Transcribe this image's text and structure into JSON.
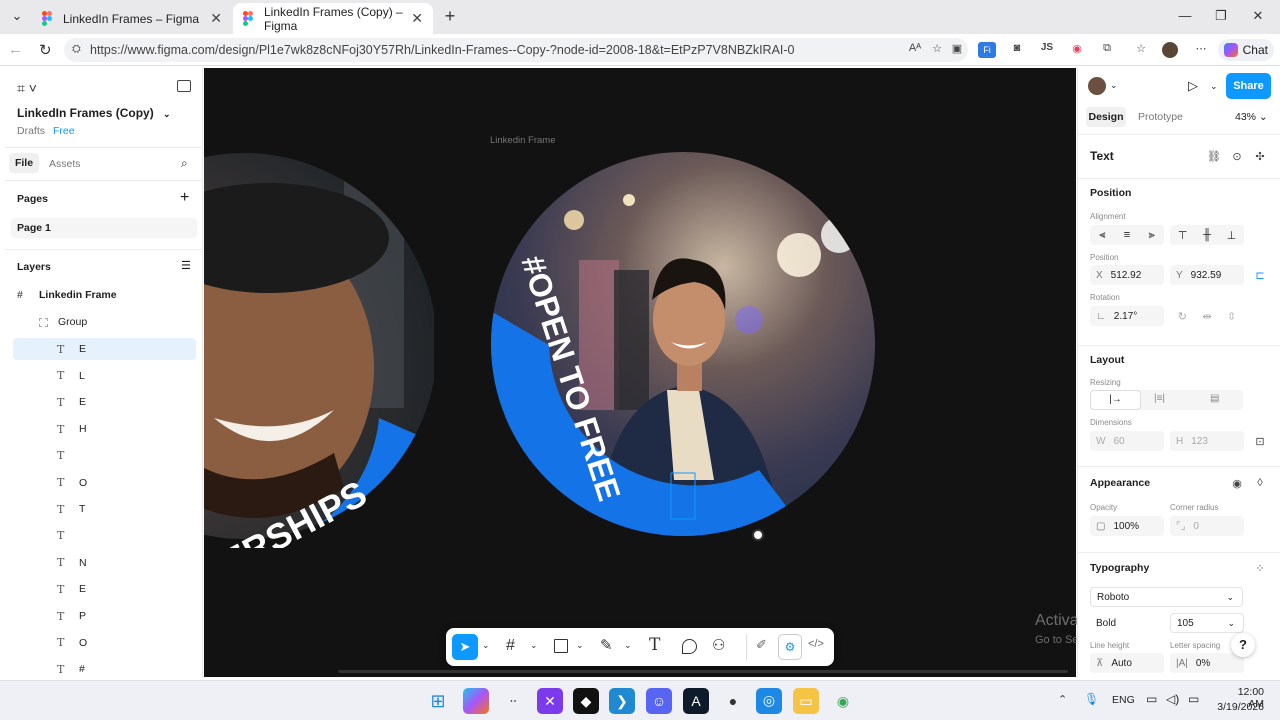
{
  "browser": {
    "tabs": [
      {
        "title": "LinkedIn Frames – Figma"
      },
      {
        "title": "LinkedIn Frames (Copy) – Figma"
      }
    ],
    "url": "https://www.figma.com/design/Pl1e7wk8z8cNFoj30Y57Rh/LinkedIn-Frames--Copy-?node-id=2008-18&t=EtPzP7V8NBZkIRAI-0",
    "ext_js": "JS",
    "chat_label": "Chat"
  },
  "left_panel": {
    "file_name": "LinkedIn Frames (Copy)",
    "drafts": "Drafts",
    "plan": "Free",
    "tab_file": "File",
    "tab_assets": "Assets",
    "pages_title": "Pages",
    "page_1": "Page 1",
    "layers_title": "Layers",
    "frame_name": "Linkedin Frame",
    "group_name": "Group",
    "text_layers": [
      "E",
      "L",
      "E",
      "H",
      "",
      "O",
      "T",
      "",
      "N",
      "E",
      "P",
      "O",
      "#"
    ]
  },
  "canvas": {
    "frame_label": "Linkedin Frame",
    "ring_text": "#OPEN TO FREE",
    "left_ring_text": "NERSHIPS",
    "watermark_title": "Activate Windows",
    "watermark_sub": "Go to Settings to activate Windows."
  },
  "right_panel": {
    "tab_design": "Design",
    "tab_prototype": "Prototype",
    "zoom": "43%",
    "share": "Share",
    "selection_type": "Text",
    "position_title": "Position",
    "alignment_label": "Alignment",
    "position_label": "Position",
    "x_label": "X",
    "x_value": "512.92",
    "y_label": "Y",
    "y_value": "932.59",
    "rotation_label": "Rotation",
    "rotation_value": "2.17°",
    "layout_title": "Layout",
    "resizing_label": "Resizing",
    "dimensions_label": "Dimensions",
    "w_label": "W",
    "w_value": "60",
    "h_label": "H",
    "h_value": "123",
    "appearance_title": "Appearance",
    "opacity_label": "Opacity",
    "opacity_value": "100%",
    "corner_label": "Corner radius",
    "corner_value": "0",
    "typography_title": "Typography",
    "font_family": "Roboto",
    "font_weight": "Bold",
    "font_size": "105",
    "line_height_label": "Line height",
    "line_height_value": "Auto",
    "letter_spacing_label": "Letter spacing",
    "letter_spacing_value": "0%"
  },
  "taskbar": {
    "lang": "ENG",
    "time": "12:00 AM",
    "date": "3/19/2026"
  },
  "colors": {
    "accent": "#0d99ff",
    "ring_blue": "#1473e6",
    "canvas_bg": "#121212"
  }
}
